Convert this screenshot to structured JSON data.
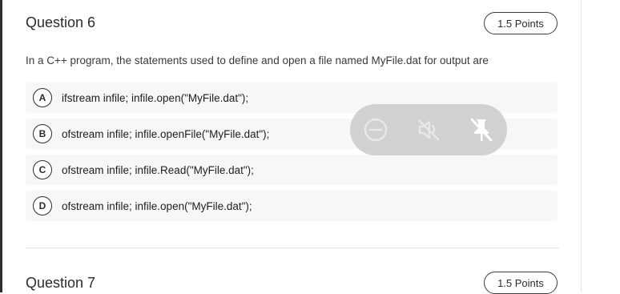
{
  "q6": {
    "title": "Question 6",
    "points": "1.5 Points",
    "prompt": "In a C++ program, the statements used to define and open a file named MyFile.dat for output are",
    "options": [
      {
        "letter": "A",
        "text": "ifstream infile; infile.open(\"MyFile.dat\");"
      },
      {
        "letter": "B",
        "text": "ofstream infile; infile.openFile(\"MyFile.dat\");"
      },
      {
        "letter": "C",
        "text": "ofstream infile; infile.Read(\"MyFile.dat\");"
      },
      {
        "letter": "D",
        "text": "ofstream infile; infile.open(\"MyFile.dat\");"
      }
    ]
  },
  "q7": {
    "title": "Question 7",
    "points": "1.5 Points"
  },
  "overlay": {
    "icons": [
      "minus-circle-icon",
      "mute-icon",
      "unpin-icon"
    ]
  }
}
